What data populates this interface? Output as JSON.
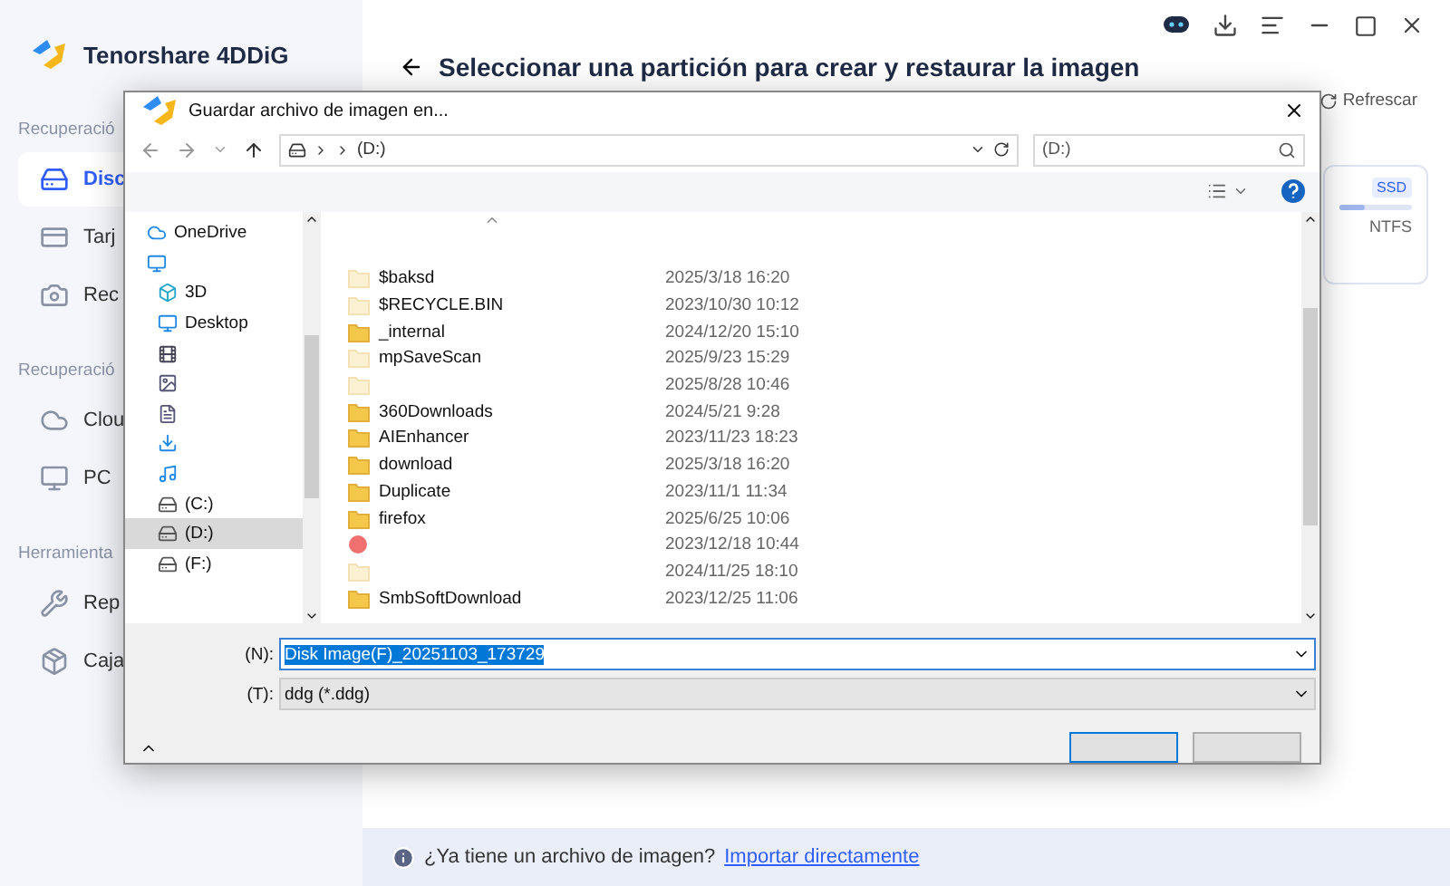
{
  "app": {
    "name": "Tenorshare 4DDiG"
  },
  "sidebar": {
    "groups": [
      {
        "label": "Recuperació",
        "items": [
          {
            "label": "Disc",
            "selected": true
          },
          {
            "label": "Tarj",
            "selected": false
          },
          {
            "label": "Rec",
            "selected": false
          }
        ]
      },
      {
        "label": "Recuperació",
        "items": [
          {
            "label": "Clou",
            "selected": false
          },
          {
            "label": "PC",
            "selected": false
          }
        ]
      },
      {
        "label": "Herramienta",
        "items": [
          {
            "label": "Rep",
            "selected": false
          },
          {
            "label": "Caja",
            "selected": false
          }
        ]
      }
    ]
  },
  "main": {
    "heading": "Seleccionar una partición para crear y restaurar la imagen",
    "refresh": "Refrescar",
    "card": {
      "badge": "SSD",
      "level": 0.35,
      "filesystem": "NTFS"
    },
    "footer": {
      "question": "¿Ya tiene un archivo de imagen?",
      "link": "Importar directamente"
    }
  },
  "dialog": {
    "title": "Guardar archivo de imagen en...",
    "address": "(D:)",
    "search": "(D:)",
    "nav": [
      {
        "label": "OneDrive",
        "selected": false
      },
      {
        "selected": false
      },
      {
        "label": "3D",
        "selected": false
      },
      {
        "label": "Desktop",
        "selected": false
      },
      {
        "selected": false
      },
      {
        "selected": false
      },
      {
        "selected": false
      },
      {
        "selected": false
      },
      {
        "selected": false
      },
      {
        "label": "(C:)",
        "selected": false
      },
      {
        "label": "(D:)",
        "selected": true
      },
      {
        "label": "(F:)",
        "selected": false
      }
    ],
    "files": [
      {
        "name": "$baksd",
        "date": "2025/3/18 16:20",
        "kind": "hidden"
      },
      {
        "name": "$RECYCLE.BIN",
        "date": "2023/10/30 10:12",
        "kind": "hidden"
      },
      {
        "name": "_internal",
        "date": "2024/12/20 15:10",
        "kind": "folder"
      },
      {
        "name": "mpSaveScan",
        "date": "2025/9/23 15:29",
        "kind": "hidden"
      },
      {
        "date": "2025/8/28 10:46",
        "kind": "hidden"
      },
      {
        "name": "360Downloads",
        "date": "2024/5/21 9:28",
        "kind": "folder"
      },
      {
        "name": "AIEnhancer",
        "date": "2023/11/23 18:23",
        "kind": "folder"
      },
      {
        "name": "download",
        "date": "2025/3/18 16:20",
        "kind": "folder"
      },
      {
        "name": "Duplicate",
        "date": "2023/11/1 11:34",
        "kind": "folder"
      },
      {
        "name": "firefox",
        "date": "2025/6/25 10:06",
        "kind": "folder"
      },
      {
        "date": "2023/12/18 10:44",
        "kind": "app"
      },
      {
        "date": "2024/11/25 18:10",
        "kind": "hidden"
      },
      {
        "name": "SmbSoftDownload",
        "date": "2023/12/25 11:06",
        "kind": "folder"
      }
    ],
    "filename_label": "(N):",
    "filename": "Disk Image(F)_20251103_173729",
    "type_label": "(T):",
    "type": "ddg (*.ddg)"
  }
}
